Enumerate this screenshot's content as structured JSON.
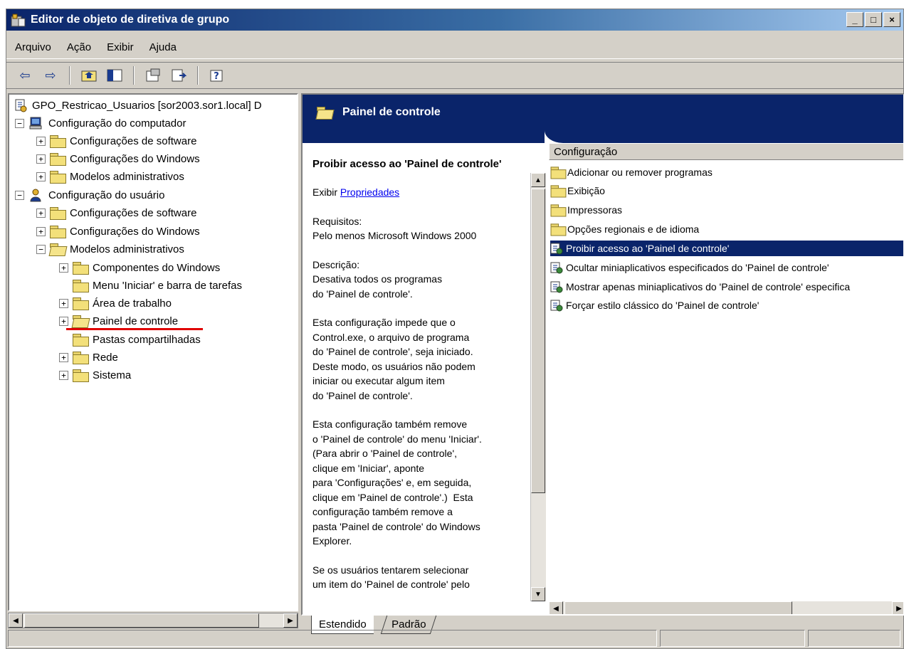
{
  "window": {
    "title": "Editor de objeto de diretiva de grupo",
    "controls": [
      "_",
      "□",
      "×"
    ]
  },
  "menu": [
    "Arquivo",
    "Ação",
    "Exibir",
    "Ajuda"
  ],
  "toolbar": {
    "buttons": [
      "back-icon",
      "forward-icon",
      "up-folder-icon",
      "show-hide-tree-icon",
      "properties-icon",
      "export-list-icon",
      "help-icon"
    ]
  },
  "tree": {
    "root": "GPO_Restricao_Usuarios [sor2003.sor1.local] D",
    "computer_config": "Configuração do computador",
    "computer_children": [
      "Configurações de software",
      "Configurações do Windows",
      "Modelos administrativos"
    ],
    "user_config": "Configuração do usuário",
    "user_children": [
      "Configurações de software",
      "Configurações do Windows",
      "Modelos administrativos"
    ],
    "admin_templates_children": [
      "Componentes do Windows",
      "Menu 'Iniciar' e barra de tarefas",
      "Área de trabalho",
      "Painel de controle",
      "Pastas compartilhadas",
      "Rede",
      "Sistema"
    ]
  },
  "right_pane": {
    "header_title": "Painel de controle",
    "description": {
      "title": "Proibir acesso ao 'Painel de controle'",
      "show_prefix": "Exibir",
      "properties_link": "Propriedades",
      "requirements_label": "Requisitos:",
      "requirements_value": "Pelo menos Microsoft Windows 2000",
      "description_label": "Descrição:",
      "desc_lines": [
        "Desativa todos os programas",
        "do 'Painel de controle'."
      ],
      "para1_lines": [
        "Esta configuração impede que o",
        "Control.exe, o arquivo de programa",
        "do 'Painel de controle', seja iniciado.",
        "Deste modo, os usuários não podem",
        "iniciar ou executar algum item",
        "do 'Painel de controle'."
      ],
      "para2_lines": [
        "Esta configuração também remove",
        "o 'Painel de controle' do menu 'Iniciar'.",
        "(Para abrir o 'Painel de controle',",
        "clique em 'Iniciar', aponte",
        "para 'Configurações' e, em seguida,",
        "clique em 'Painel de controle'.)  Esta",
        "configuração também remove a",
        "pasta 'Painel de controle' do Windows",
        "Explorer."
      ],
      "para3_lines": [
        "Se os usuários tentarem selecionar",
        "um item do 'Painel de controle' pelo"
      ]
    },
    "list": {
      "column_header": "Configuração",
      "folders": [
        "Adicionar ou remover programas",
        "Exibição",
        "Impressoras",
        "Opções regionais e de idioma"
      ],
      "settings": [
        "Proibir acesso ao 'Painel de controle'",
        "Ocultar miniaplicativos especificados do 'Painel de controle'",
        "Mostrar apenas miniaplicativos do 'Painel de controle' especifica",
        "Forçar estilo clássico do 'Painel de controle'"
      ],
      "selected_index": 0
    },
    "tabs": [
      "Estendido",
      "Padrão"
    ],
    "active_tab": "Estendido"
  },
  "colors": {
    "title_bar": "#0a246a",
    "selection": "#0a246a",
    "window_bg": "#d4d0c8",
    "highlight_underline": "#e00000",
    "link": "#0000ee"
  }
}
